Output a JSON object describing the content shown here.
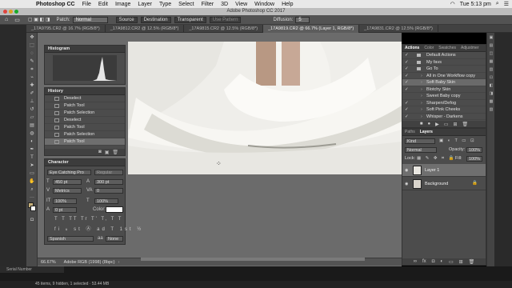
{
  "menubar": {
    "app": "Photoshop CC",
    "items": [
      "File",
      "Edit",
      "Image",
      "Layer",
      "Type",
      "Select",
      "Filter",
      "3D",
      "View",
      "Window",
      "Help"
    ],
    "clock": "Tue 5:13 pm"
  },
  "window": {
    "title": "Adobe Photoshop CC 2017"
  },
  "options": {
    "patch_label": "Patch:",
    "patch_mode": "Normal",
    "source": "Source",
    "destination": "Destination",
    "transparent": "Transparent",
    "use_pattern": "Use Pattern",
    "diffusion_label": "Diffusion:",
    "diffusion_value": "5"
  },
  "tabs": [
    "_17A9795.CR2 @ 16.7% (RGB/8*)",
    "_17A9812.CR2 @ 12.5% (RGB/8*)",
    "_17A9815.CR2 @ 12.5% (RGB/8*)",
    "_17A9819.CR2 @ 66.7% (Layer 1, RGB/8*)",
    "_17A9831.CR2 @ 12.5% (RGB/8*)"
  ],
  "histogram": {
    "title": "Histogram"
  },
  "history": {
    "title": "History",
    "items": [
      "Deselect",
      "Patch Tool",
      "Patch Selection",
      "Deselect",
      "Patch Tool",
      "Patch Selection",
      "Patch Tool"
    ]
  },
  "character": {
    "title": "Character",
    "font_family": "Eye Catching Pro",
    "font_style": "Regular",
    "size": "450 pt",
    "leading": "300 pt",
    "kerning": "Metrics",
    "tracking": "0",
    "vscale": "100%",
    "hscale": "100%",
    "baseline": "0 pt",
    "color_label": "Color:",
    "glyphs": "T T TT Tr T' T, T T",
    "language": "Spanish",
    "aa": "None"
  },
  "status": {
    "zoom": "66.67%",
    "profile": "Adobe RGB (1998) (8bpc)"
  },
  "actions": {
    "tabs": [
      "Actions",
      "Color",
      "Swatches",
      "Adjustmer"
    ],
    "items": [
      {
        "label": "Default Actions",
        "check": "✓",
        "type": "set"
      },
      {
        "label": "My favs",
        "check": "✓",
        "type": "set"
      },
      {
        "label": "Go To",
        "check": "✓",
        "type": "set"
      },
      {
        "label": "All in One Workflow copy",
        "check": "✓",
        "type": "action"
      },
      {
        "label": "Soft Baby Skin",
        "check": "✓",
        "type": "action"
      },
      {
        "label": "Blotchy Skin",
        "check": "✓",
        "type": "action"
      },
      {
        "label": "Sweet Baby copy",
        "check": "",
        "type": "action"
      },
      {
        "label": "Sharpen/Defog",
        "check": "✓",
        "type": "action"
      },
      {
        "label": "Soft Pink Cheeks",
        "check": "✓",
        "type": "action"
      },
      {
        "label": "Whisper - Darkens",
        "check": "✓",
        "type": "action"
      }
    ]
  },
  "layers": {
    "tabs": [
      "Paths",
      "Layers"
    ],
    "kind": "Kind",
    "blend": "Normal",
    "opacity_label": "Opacity:",
    "opacity": "100%",
    "lock_label": "Lock:",
    "fill_label": "Fill:",
    "fill": "100%",
    "items": [
      {
        "name": "Layer 1"
      },
      {
        "name": "Background"
      }
    ]
  },
  "finder": {
    "serial": "Serial Number",
    "footer": "45 items, 9 hidden, 1 selected · 53.44 MB"
  }
}
